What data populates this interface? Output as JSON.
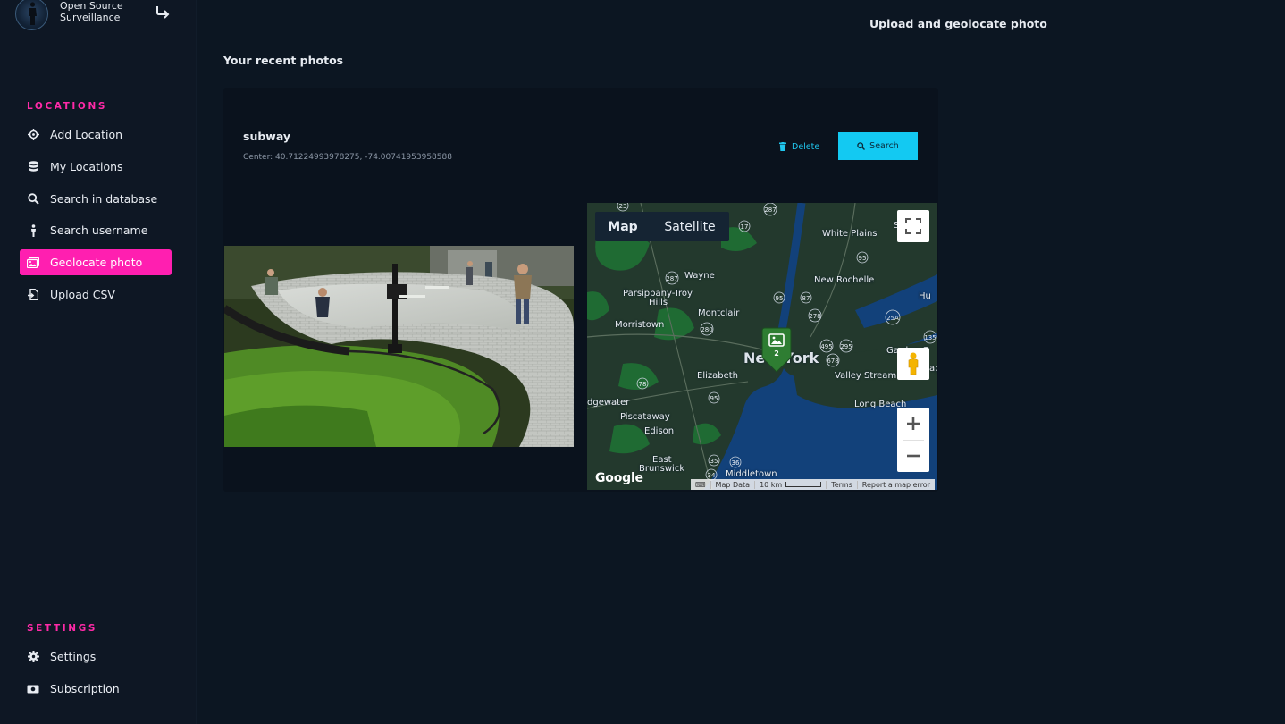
{
  "brand": {
    "name": "Open Source Surveillance"
  },
  "sidebar": {
    "locations_title": "LOCATIONS",
    "locations": [
      {
        "label": "Add Location",
        "icon": "crosshair-icon"
      },
      {
        "label": "My Locations",
        "icon": "database-icon"
      },
      {
        "label": "Search in database",
        "icon": "search-icon"
      },
      {
        "label": "Search username",
        "icon": "person-icon"
      },
      {
        "label": "Geolocate photo",
        "icon": "images-icon",
        "active": true
      },
      {
        "label": "Upload CSV",
        "icon": "file-import-icon"
      }
    ],
    "settings_title": "SETTINGS",
    "settings": [
      {
        "label": "Settings",
        "icon": "gear-icon"
      },
      {
        "label": "Subscription",
        "icon": "money-bill-icon"
      }
    ]
  },
  "header": {
    "top_link": "Upload and geolocate photo"
  },
  "main": {
    "heading": "Your recent photos",
    "card": {
      "title": "subway",
      "center_text": "Center: 40.71224993978275, -74.00741953958588",
      "delete_label": "Delete",
      "search_label": "Search"
    }
  },
  "map": {
    "tab_map": "Map",
    "tab_satellite": "Satellite",
    "marker_count": "2",
    "google": "Google",
    "attribution": {
      "map_data": "Map Data",
      "scale": "10 km",
      "terms": "Terms",
      "report": "Report a map error"
    },
    "labels": {
      "white_plains": "White Plains",
      "wayne": "Wayne",
      "parsippany": "Parsippany-Troy",
      "hills": "Hills",
      "new_rochelle": "New Rochelle",
      "montclair": "Montclair",
      "morristown": "Morristown",
      "new_york": "New York",
      "garden": "Garden C",
      "valley_stream": "Valley Stream",
      "elizabeth": "Elizabeth",
      "long_beach": "Long Beach",
      "edgewater": "dgewater",
      "piscataway": "Piscataway",
      "edison": "Edison",
      "east": "East",
      "brunswick": "Brunswick",
      "middletown": "Middletown",
      "hu": "Hu",
      "ap": "ap",
      "s": "S"
    },
    "highway_shields": [
      "23",
      "287",
      "17",
      "95",
      "80",
      "287",
      "95",
      "87",
      "280",
      "278",
      "25A",
      "495",
      "295",
      "678",
      "135",
      "78",
      "95",
      "35",
      "36",
      "34"
    ]
  },
  "colors": {
    "accent_pink": "#ff1fb0",
    "accent_cyan": "#13c9f2",
    "bg": "#0c1622",
    "card": "#0a121d"
  }
}
